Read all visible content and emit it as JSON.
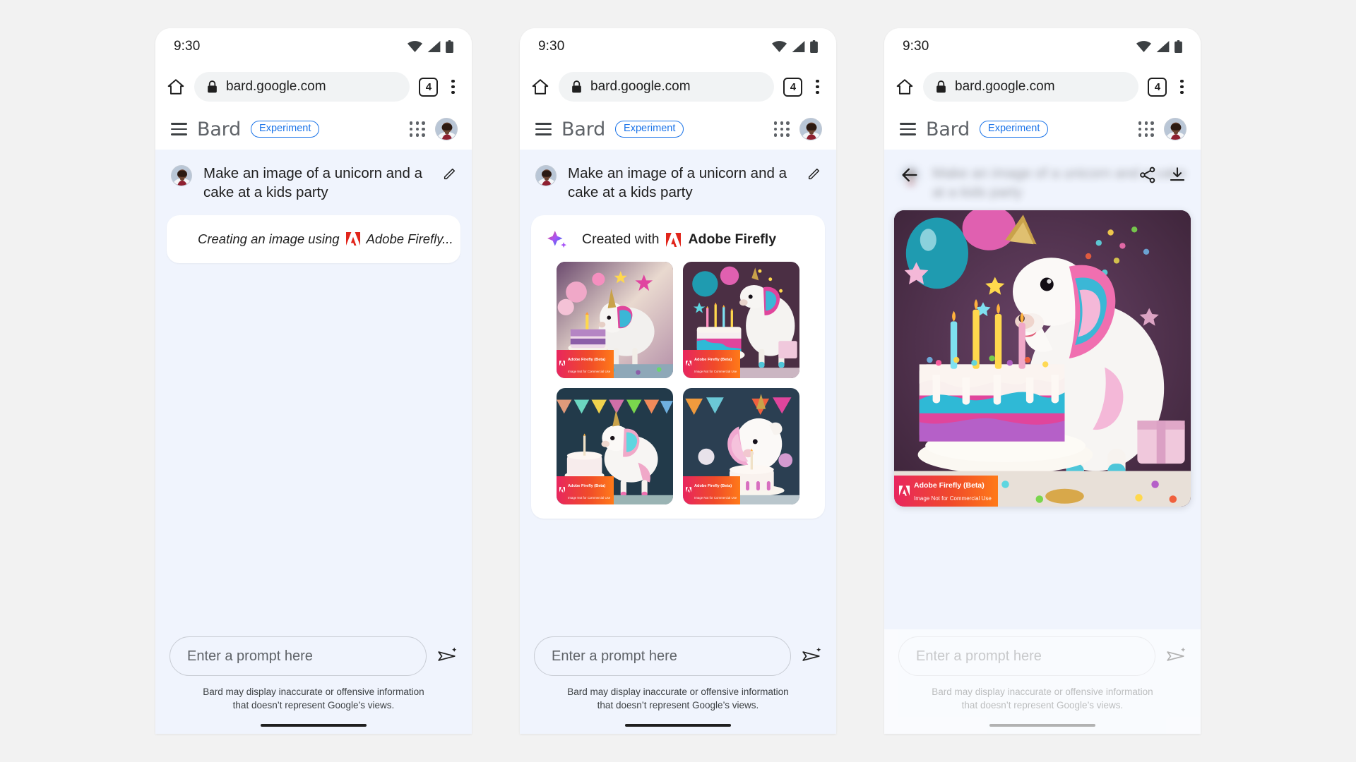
{
  "background_color": "#f2f2f2",
  "accent_color": "#1a73e8",
  "chat_bg_color": "#f0f4fd",
  "status_bar": {
    "time": "9:30",
    "icons": [
      "wifi-icon",
      "cellular-signal-icon",
      "battery-icon"
    ]
  },
  "browser": {
    "home_icon": "home-icon",
    "lock_icon": "lock-icon",
    "url": "bard.google.com",
    "tab_count": "4",
    "menu_icon": "kebab-menu-icon"
  },
  "app_bar": {
    "menu_icon": "hamburger-menu-icon",
    "title": "Bard",
    "badge": "Experiment",
    "apps_icon": "google-apps-grid-icon",
    "avatar": "user-avatar"
  },
  "conversation": {
    "user_prompt": "Make an image of a unicorn and a cake at a kids party",
    "edit_icon": "pencil-edit-icon"
  },
  "panel1": {
    "loading_text": "Creating an image using",
    "provider": "Adobe Firefly...",
    "sparkle_icon": "sparkle-icon",
    "adobe_icon": "adobe-logo-icon"
  },
  "panel2": {
    "result_prefix": "Created with",
    "provider": "Adobe Firefly",
    "sparkle_icon": "sparkle-icon",
    "adobe_icon": "adobe-logo-icon",
    "image_count": 4,
    "image_alts": [
      "Unicorn with rainbow mane beside a purple layer cake with balloons",
      "Unicorn beside rainbow cake with five lit candles and gifts",
      "Unicorn with pastel mane beside tiered cake under party bunting",
      "Unicorn with pink mane beside drip cake with candle and balloons"
    ]
  },
  "panel3": {
    "back_icon": "back-arrow-icon",
    "share_icon": "share-icon",
    "download_icon": "download-icon",
    "hero_alt": "Large unicorn beside rainbow birthday cake with four lit candles"
  },
  "watermark": {
    "line1": "Adobe Firefly (Beta)",
    "line2": "Image Not for Commercial Use",
    "gradient_from": "#e8265f",
    "gradient_to": "#ff7a18"
  },
  "composer": {
    "placeholder": "Enter a prompt here",
    "value": "",
    "send_icon": "send-sparkle-icon"
  },
  "disclaimer": "Bard may display inaccurate or offensive information that doesn’t represent Google’s views.",
  "home_indicator": "home-indicator-bar"
}
